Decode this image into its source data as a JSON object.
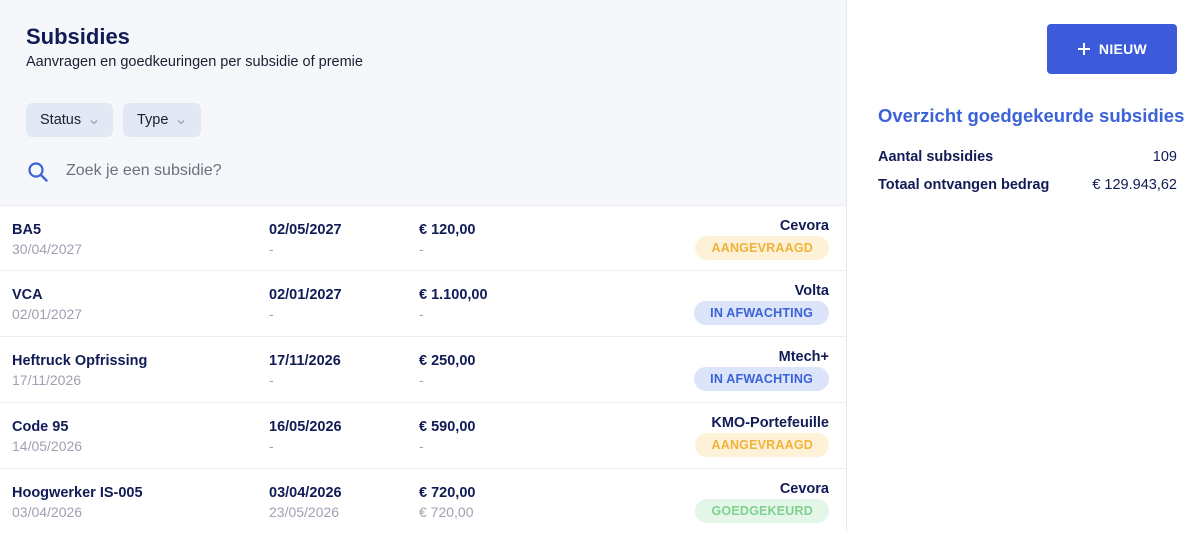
{
  "header": {
    "title": "Subsidies",
    "subtitle": "Aanvragen en goedkeuringen per subsidie of premie"
  },
  "filters": [
    {
      "label": "Status",
      "icon": "chevron-down-icon"
    },
    {
      "label": "Type",
      "icon": "chevron-down-icon"
    }
  ],
  "search": {
    "placeholder": "Zoek je een subsidie?",
    "value": "",
    "icon": "search-icon"
  },
  "rows": [
    {
      "name": "BA5",
      "name_date": "30/04/2027",
      "date": "02/05/2027",
      "date_sub": "-",
      "amount": "€ 120,00",
      "amount_sub": "-",
      "org": "Cevora",
      "status": "AANGEVRAAGD",
      "status_kind": "requested"
    },
    {
      "name": "VCA",
      "name_date": "02/01/2027",
      "date": "02/01/2027",
      "date_sub": "-",
      "amount": "€ 1.100,00",
      "amount_sub": "-",
      "org": "Volta",
      "status": "IN AFWACHTING",
      "status_kind": "pending"
    },
    {
      "name": "Heftruck Opfrissing",
      "name_date": "17/11/2026",
      "date": "17/11/2026",
      "date_sub": "-",
      "amount": "€ 250,00",
      "amount_sub": "-",
      "org": "Mtech+",
      "status": "IN AFWACHTING",
      "status_kind": "pending"
    },
    {
      "name": "Code 95",
      "name_date": "14/05/2026",
      "date": "16/05/2026",
      "date_sub": "-",
      "amount": "€ 590,00",
      "amount_sub": "-",
      "org": "KMO-Portefeuille",
      "status": "AANGEVRAAGD",
      "status_kind": "requested"
    },
    {
      "name": "Hoogwerker IS-005",
      "name_date": "03/04/2026",
      "date": "03/04/2026",
      "date_sub": "23/05/2026",
      "amount": "€ 720,00",
      "amount_sub": "€ 720,00",
      "org": "Cevora",
      "status": "GOEDGEKEURD",
      "status_kind": "approved"
    }
  ],
  "status_colors": {
    "requested": {
      "bg": "#fdf1d8",
      "fg": "#f0b33a"
    },
    "pending": {
      "bg": "#dbe4f8",
      "fg": "#3b62d9"
    },
    "approved": {
      "bg": "#e4f6e8",
      "fg": "#7fd18f"
    }
  },
  "sidebar": {
    "new_button": {
      "label": "NIEUW",
      "icon": "plus-icon"
    },
    "overview_title": "Overzicht goedgekeurde subsidies",
    "stats": [
      {
        "label": "Aantal subsidies",
        "value": "109"
      },
      {
        "label": "Totaal ontvangen bedrag",
        "value": "€ 129.943,62"
      }
    ]
  },
  "colors": {
    "accent": "#3b5bdb",
    "title": "#111b55",
    "muted": "#9ea2b0"
  }
}
